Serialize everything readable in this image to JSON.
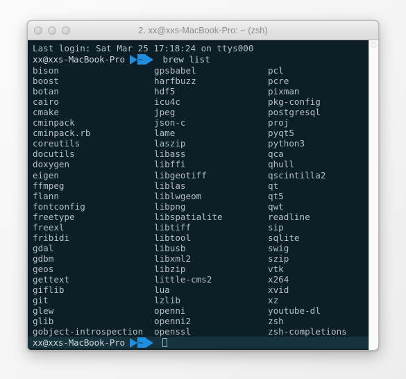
{
  "window": {
    "title": "2. xx@xxs-MacBook-Pro: ~ (zsh)",
    "colors": {
      "terminal_background": "#0c1f26",
      "terminal_text": "#b6bfc2",
      "powerline_accent": "#1e8fe0",
      "prompt_highlight": "#16333d",
      "titlebar": "#e4e4e4",
      "desktop": "#f7f7f7"
    },
    "traffic_lights": [
      {
        "name": "close",
        "color": "#d2d2d2"
      },
      {
        "name": "minimize",
        "color": "#d2d2d2"
      },
      {
        "name": "zoom",
        "color": "#d2d2d2"
      }
    ]
  },
  "terminal": {
    "login_line": "Last login: Sat Mar 25 17:18:24 on ttys000",
    "prompt_top": {
      "host": "xx@xxs-MacBook-Pro",
      "segment": "~",
      "command": "brew list"
    },
    "prompt_bottom": {
      "host": "xx@xxs-MacBook-Pro",
      "segment": "~",
      "command": ""
    },
    "columns": {
      "col1": [
        "bison",
        "boost",
        "botan",
        "cairo",
        "cmake",
        "cminpack",
        "cminpack.rb",
        "coreutils",
        "docutils",
        "doxygen",
        "eigen",
        "ffmpeg",
        "flann",
        "fontconfig",
        "freetype",
        "freexl",
        "fribidi",
        "gdal",
        "gdbm",
        "geos",
        "gettext",
        "giflib",
        "git",
        "glew",
        "glib",
        "gobject-introspection"
      ],
      "col2": [
        "gpsbabel",
        "harfbuzz",
        "hdf5",
        "icu4c",
        "jpeg",
        "json-c",
        "lame",
        "laszip",
        "libass",
        "libffi",
        "libgeotiff",
        "liblas",
        "liblwgeom",
        "libpng",
        "libspatialite",
        "libtiff",
        "libtool",
        "libusb",
        "libxml2",
        "libzip",
        "little-cms2",
        "lua",
        "lzlib",
        "openni",
        "openni2",
        "openssl"
      ],
      "col3": [
        "pcl",
        "pcre",
        "pixman",
        "pkg-config",
        "postgresql",
        "proj",
        "pyqt5",
        "python3",
        "qca",
        "qhull",
        "qscintilla2",
        "qt",
        "qt5",
        "qwt",
        "readline",
        "sip",
        "sqlite",
        "swig",
        "szip",
        "vtk",
        "x264",
        "xvid",
        "xz",
        "youtube-dl",
        "zsh",
        "zsh-completions"
      ]
    }
  }
}
